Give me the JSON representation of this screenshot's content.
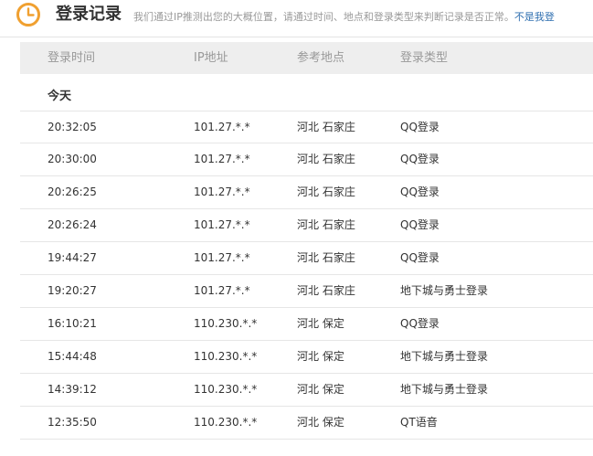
{
  "header": {
    "title": "登录记录",
    "description": "我们通过IP推测出您的大概位置，请通过时间、地点和登录类型来判断记录是否正常。",
    "link_label": "不是我登"
  },
  "table": {
    "columns": [
      "登录时间",
      "IP地址",
      "参考地点",
      "登录类型"
    ],
    "group_label": "今天",
    "rows": [
      {
        "time": "20:32:05",
        "ip": "101.27.*.*",
        "location": "河北 石家庄",
        "type": "QQ登录"
      },
      {
        "time": "20:30:00",
        "ip": "101.27.*.*",
        "location": "河北 石家庄",
        "type": "QQ登录"
      },
      {
        "time": "20:26:25",
        "ip": "101.27.*.*",
        "location": "河北 石家庄",
        "type": "QQ登录"
      },
      {
        "time": "20:26:24",
        "ip": "101.27.*.*",
        "location": "河北 石家庄",
        "type": "QQ登录"
      },
      {
        "time": "19:44:27",
        "ip": "101.27.*.*",
        "location": "河北 石家庄",
        "type": "QQ登录"
      },
      {
        "time": "19:20:27",
        "ip": "101.27.*.*",
        "location": "河北 石家庄",
        "type": "地下城与勇士登录"
      },
      {
        "time": "16:10:21",
        "ip": "110.230.*.*",
        "location": "河北 保定",
        "type": "QQ登录"
      },
      {
        "time": "15:44:48",
        "ip": "110.230.*.*",
        "location": "河北 保定",
        "type": "地下城与勇士登录"
      },
      {
        "time": "14:39:12",
        "ip": "110.230.*.*",
        "location": "河北 保定",
        "type": "地下城与勇士登录"
      },
      {
        "time": "12:35:50",
        "ip": "110.230.*.*",
        "location": "河北 保定",
        "type": "QT语音"
      }
    ]
  },
  "colors": {
    "accent": "#f0a030",
    "link": "#2f6fb0",
    "header_bg": "#eeeeee"
  },
  "icons": {
    "header_icon": "clock-icon"
  }
}
